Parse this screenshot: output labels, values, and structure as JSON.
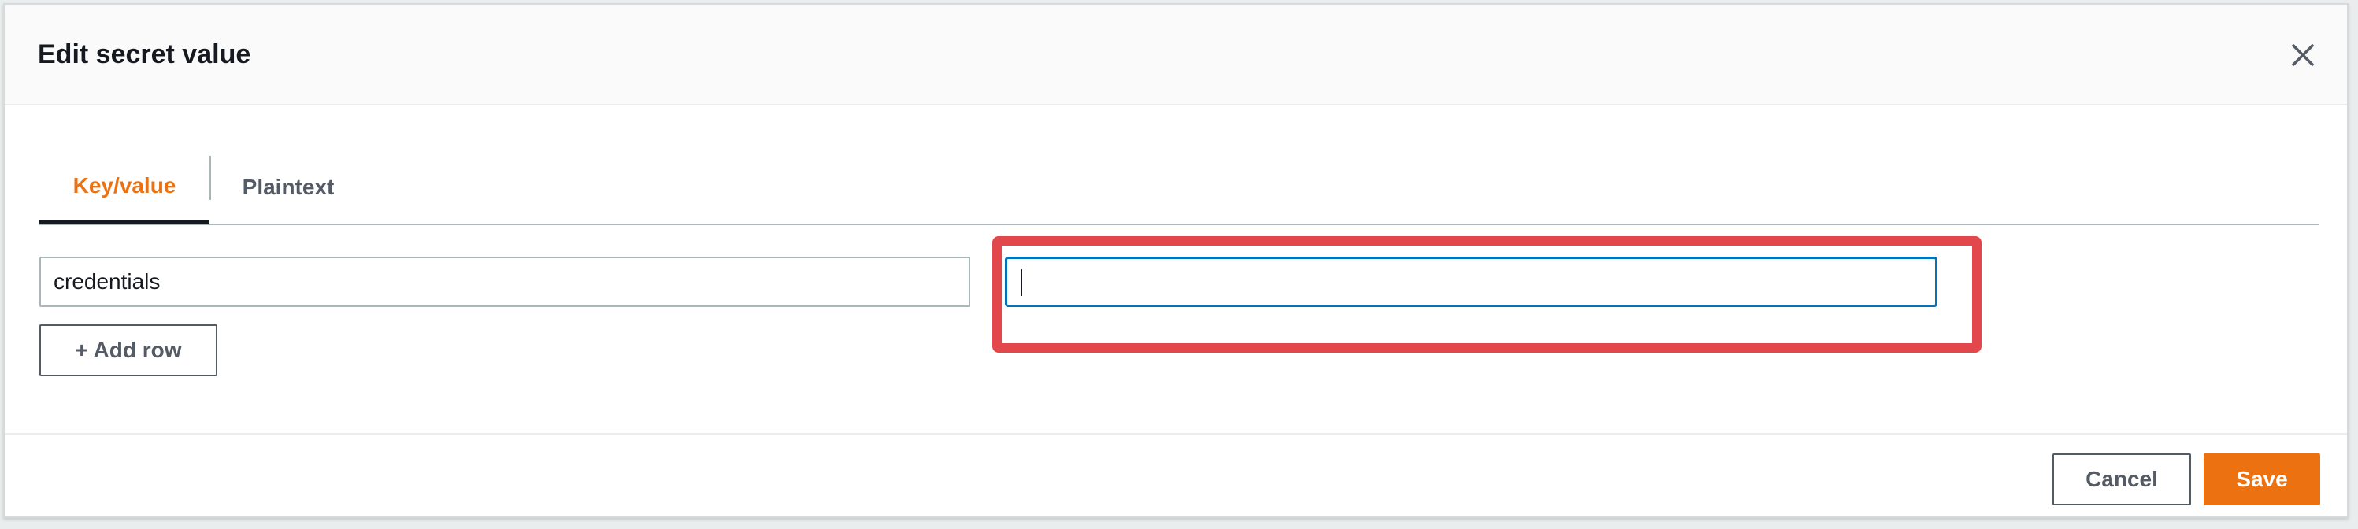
{
  "modal": {
    "title": "Edit secret value",
    "close_icon": "close-icon"
  },
  "tabs": [
    {
      "label": "Key/value",
      "active": true
    },
    {
      "label": "Plaintext",
      "active": false
    }
  ],
  "row": {
    "key_value": "credentials",
    "value_value": ""
  },
  "add_row_label": "+ Add row",
  "footer": {
    "cancel_label": "Cancel",
    "save_label": "Save"
  },
  "colors": {
    "accent": "#ec7211",
    "focus": "#0073bb",
    "highlight": "#e2474b",
    "text": "#16191f"
  }
}
